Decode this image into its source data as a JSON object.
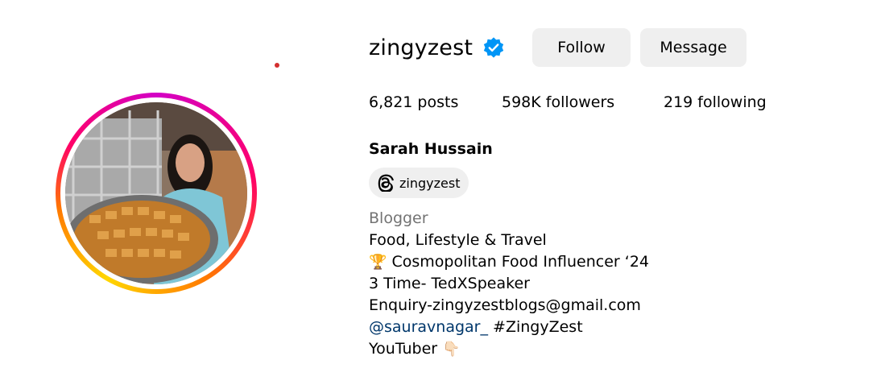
{
  "profile": {
    "username": "zingyzest",
    "verified_icon": "verified-badge-icon",
    "full_name": "Sarah Hussain",
    "threads_handle": "zingyzest"
  },
  "actions": {
    "follow_label": "Follow",
    "message_label": "Message"
  },
  "stats": {
    "posts": "6,821 posts",
    "followers": "598K followers",
    "following": "219 following"
  },
  "bio": {
    "category": "Blogger",
    "line1": "Food, Lifestyle & Travel",
    "line2_emoji": "🏆",
    "line2_text": " Cosmopolitan Food Influencer ‘24",
    "line3": "3 Time- TedXSpeaker",
    "line4": "Enquiry-zingyzestblogs@gmail.com",
    "mention": "@sauravnagar_",
    "hashtag": " #ZingyZest",
    "line6_text": "YouTuber ",
    "line6_emoji": "👇🏻"
  },
  "colors": {
    "button_bg": "#efefef",
    "verified_blue": "#0095f6",
    "category_gray": "#737373",
    "link_blue": "#00376b"
  }
}
